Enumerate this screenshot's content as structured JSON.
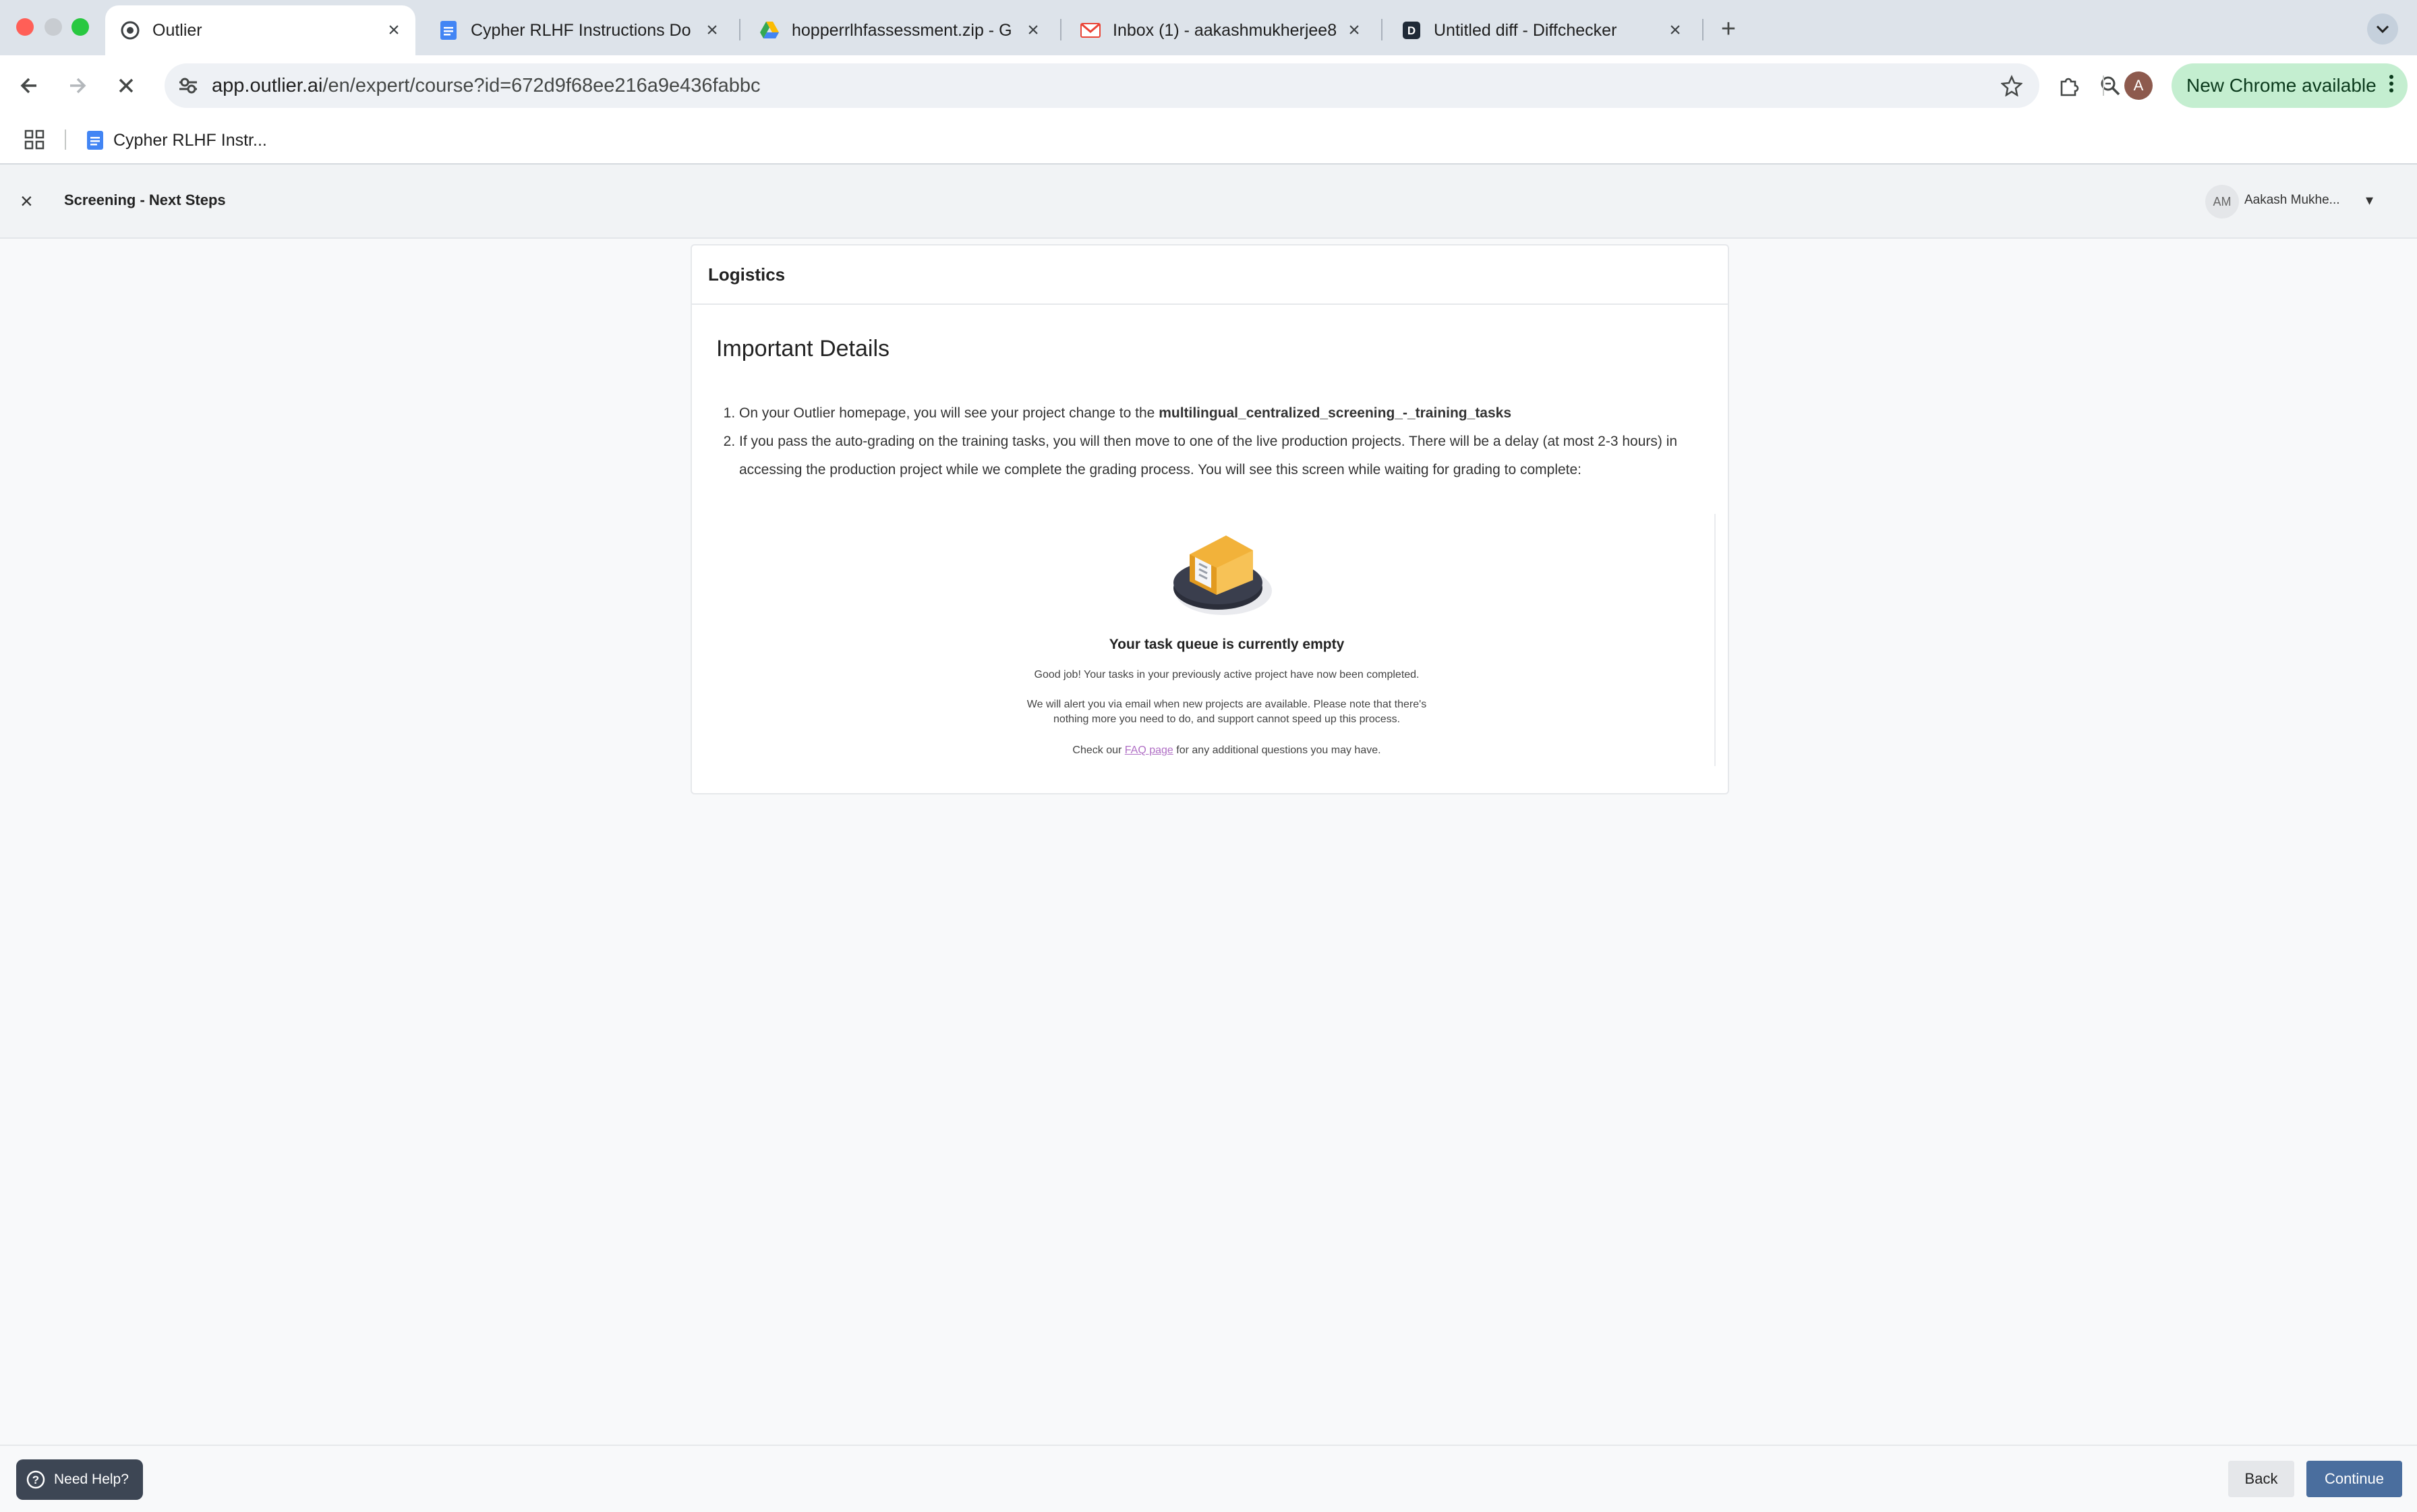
{
  "browser": {
    "tabs": [
      {
        "title": "Outlier",
        "icon": "outlier-logo-icon",
        "active": true
      },
      {
        "title": "Cypher RLHF Instructions Do",
        "icon": "google-docs-icon",
        "active": false
      },
      {
        "title": "hopperrlhfassessment.zip - G",
        "icon": "google-drive-icon",
        "active": false
      },
      {
        "title": "Inbox (1) - aakashmukherjee8",
        "icon": "gmail-icon",
        "active": false
      },
      {
        "title": "Untitled diff - Diffchecker",
        "icon": "diffchecker-icon",
        "active": false
      }
    ],
    "url_host": "app.outlier.ai",
    "url_path": "/en/expert/course?id=672d9f68ee216a9e436fabbc",
    "new_chrome_label": "New Chrome available",
    "profile_initial": "A",
    "bookmark_label": "Cypher RLHF Instr..."
  },
  "header": {
    "title": "Screening - Next Steps",
    "user_initials": "AM",
    "user_name": "Aakash Mukhe..."
  },
  "card": {
    "section_label": "Logistics",
    "heading": "Important Details",
    "item1_text": "On your Outlier homepage, you will see your project change to the ",
    "item1_bold": "multilingual_centralized_screening_-_training_tasks",
    "item2_text": "If you pass the auto-grading on the training tasks, you will then move to one of the live production projects. There will be a delay (at most 2-3 hours) in accessing the production project while we complete the grading process. You will see this screen while waiting for grading to complete:"
  },
  "empty_state": {
    "title": "Your task queue is currently empty",
    "line1": "Good job! Your tasks in your previously active project have now been completed.",
    "line2a": "We will alert you via email when new projects are available. Please note that there's",
    "line2b": "nothing more you need to do, and support cannot speed up this process.",
    "check_prefix": "Check our ",
    "faq_link": "FAQ page",
    "check_suffix": " for any additional questions you may have."
  },
  "footer": {
    "help_label": "Need Help?",
    "back_label": "Back",
    "continue_label": "Continue"
  },
  "colors": {
    "primary_button": "#4a6e9e",
    "new_chrome_pill": "#c4eed0",
    "faq_link": "#b06fc5"
  }
}
